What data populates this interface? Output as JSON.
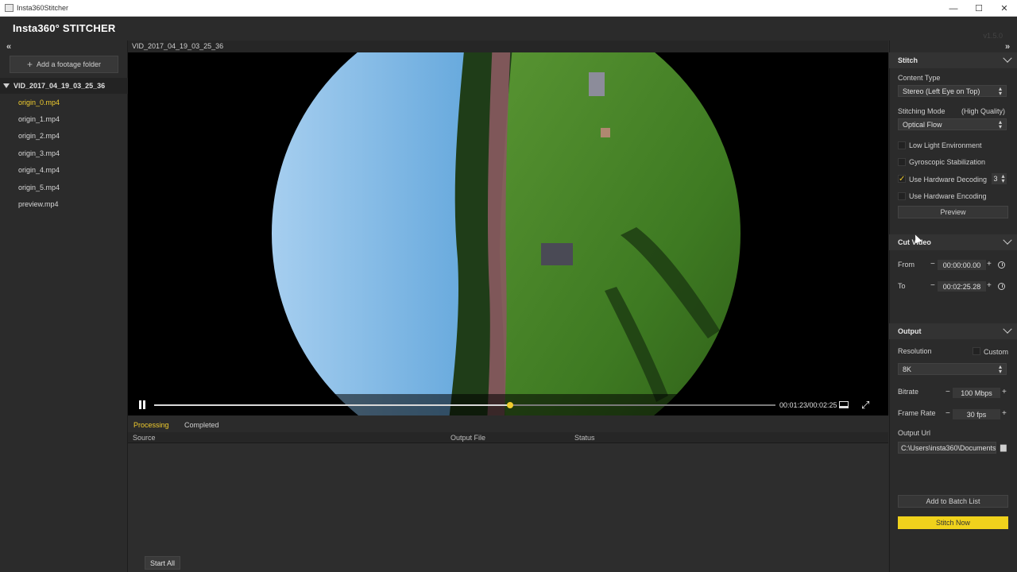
{
  "window": {
    "title": "Insta360Stitcher",
    "minimize": "—",
    "maximize": "☐",
    "close": "✕"
  },
  "header": {
    "logo": "Insta360° STITCHER",
    "version": "v1.5.0"
  },
  "left": {
    "add_folder": "Add a footage folder",
    "folder": "VID_2017_04_19_03_25_36",
    "files": [
      "origin_0.mp4",
      "origin_1.mp4",
      "origin_2.mp4",
      "origin_3.mp4",
      "origin_4.mp4",
      "origin_5.mp4",
      "preview.mp4"
    ],
    "active_file": "origin_0.mp4"
  },
  "player": {
    "video_name": "VID_2017_04_19_03_25_36",
    "timecode": "00:01:23/00:02:25",
    "progress": 0.573
  },
  "tasks": {
    "tabs": [
      "Processing",
      "Completed"
    ],
    "active_tab": "Processing",
    "columns": [
      "Source",
      "Output File",
      "Status"
    ],
    "start_all": "Start All"
  },
  "stitch": {
    "title": "Stitch",
    "content_type_label": "Content Type",
    "content_type": "Stereo (Left Eye on Top)",
    "mode_label": "Stitching Mode",
    "mode_quality": "(High Quality)",
    "mode": "Optical Flow",
    "low_light": "Low Light Environment",
    "gyro": "Gyroscopic Stabilization",
    "hw_decoding": "Use Hardware Decoding",
    "hw_decoding_count": "3",
    "hw_encoding": "Use Hardware Encoding",
    "preview": "Preview",
    "checks": {
      "low_light": false,
      "gyro": false,
      "hw_decoding": true,
      "hw_encoding": false
    }
  },
  "cut": {
    "title": "Cut Video",
    "from_label": "From",
    "from": "00:00:00.00",
    "to_label": "To",
    "to": "00:02:25.28"
  },
  "output": {
    "title": "Output",
    "resolution_label": "Resolution",
    "custom": "Custom",
    "resolution": "8K",
    "bitrate_label": "Bitrate",
    "bitrate": "100 Mbps",
    "framerate_label": "Frame Rate",
    "framerate": "30 fps",
    "url_label": "Output Url",
    "url": "C:\\Users\\insta360\\Documents\\",
    "add_batch": "Add to Batch List",
    "stitch_now": "Stitch Now"
  },
  "colors": {
    "accent": "#f0cc2e",
    "stitch_button": "#f0d21c",
    "panel": "#2b2b2b"
  }
}
